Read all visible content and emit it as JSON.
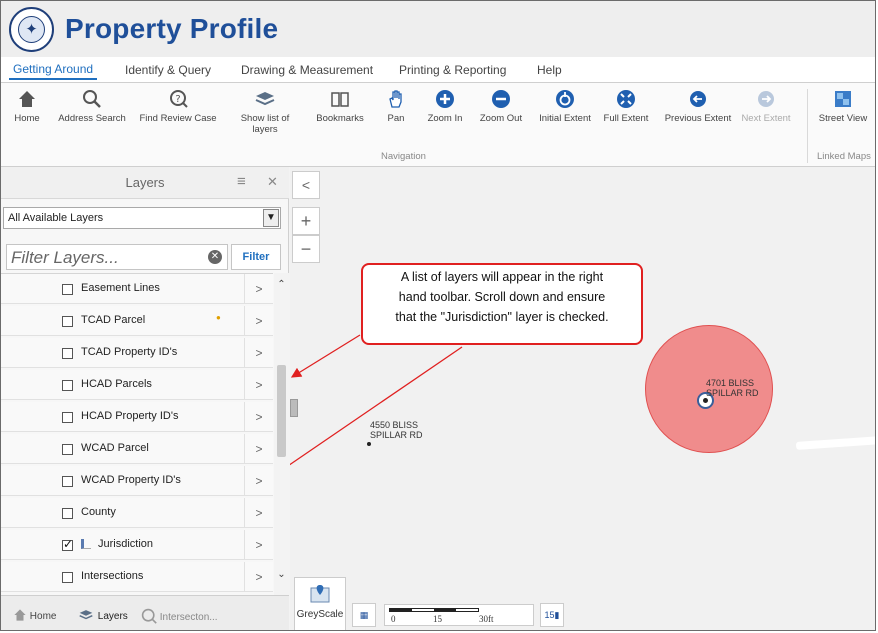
{
  "app": {
    "title": "Property Profile"
  },
  "tabs": [
    {
      "label": "Getting Around",
      "active": true
    },
    {
      "label": "Identify & Query",
      "active": false
    },
    {
      "label": "Drawing & Measurement",
      "active": false
    },
    {
      "label": "Printing & Reporting",
      "active": false
    },
    {
      "label": "Help",
      "active": false
    }
  ],
  "ribbon": {
    "tools": [
      {
        "label": "Home",
        "icon": "home-icon"
      },
      {
        "label": "Address Search",
        "icon": "search-icon"
      },
      {
        "label": "Find Review Case",
        "icon": "find-case-icon"
      },
      {
        "label": "Show list of layers",
        "icon": "layers-icon"
      },
      {
        "label": "Bookmarks",
        "icon": "bookmark-icon"
      },
      {
        "label": "Pan",
        "icon": "pan-hand-icon"
      },
      {
        "label": "Zoom In",
        "icon": "zoom-in-icon"
      },
      {
        "label": "Zoom Out",
        "icon": "zoom-out-icon"
      },
      {
        "label": "Initial Extent",
        "icon": "initial-extent-icon"
      },
      {
        "label": "Full Extent",
        "icon": "full-extent-icon"
      },
      {
        "label": "Previous Extent",
        "icon": "previous-extent-icon"
      },
      {
        "label": "Next Extent",
        "icon": "next-extent-icon"
      },
      {
        "label": "Street View",
        "icon": "street-view-icon"
      }
    ],
    "groups": {
      "navigation": "Navigation",
      "linked_maps": "Linked Maps"
    }
  },
  "panel": {
    "title": "Layers",
    "select_value": "All Available Layers",
    "filter_placeholder": "Filter Layers...",
    "filter_button": "Filter",
    "layers": [
      {
        "label": "Easement Lines",
        "checked": false
      },
      {
        "label": "TCAD Parcel",
        "checked": false
      },
      {
        "label": "TCAD Property ID's",
        "checked": false
      },
      {
        "label": "HCAD Parcels",
        "checked": false
      },
      {
        "label": "HCAD Property ID's",
        "checked": false
      },
      {
        "label": "WCAD Parcel",
        "checked": false
      },
      {
        "label": "WCAD Property ID's",
        "checked": false
      },
      {
        "label": "County",
        "checked": false
      },
      {
        "label": "Jurisdiction",
        "checked": true
      },
      {
        "label": "Intersections",
        "checked": false
      }
    ],
    "bottom_tabs": [
      {
        "label": "Home",
        "icon": "home-icon"
      },
      {
        "label": "Layers",
        "icon": "layers-icon"
      },
      {
        "label": "Intersecton...",
        "icon": "intersection-icon"
      }
    ]
  },
  "map": {
    "callout_lines": [
      "A list of layers will appear in the right",
      "hand toolbar.  Scroll down and ensure",
      "that the \"Jurisdiction\" layer is checked."
    ],
    "labels": [
      {
        "line1": "4550 BLISS",
        "line2": "SPILLAR RD"
      },
      {
        "line1": "4701 BLISS",
        "line2": "SPILLAR RD"
      }
    ],
    "basemap_label": "GreyScale",
    "scale_ticks": [
      "0",
      "15",
      "30ft"
    ],
    "highlight_color": "#f08c8c",
    "annotation_color": "#e02020"
  }
}
